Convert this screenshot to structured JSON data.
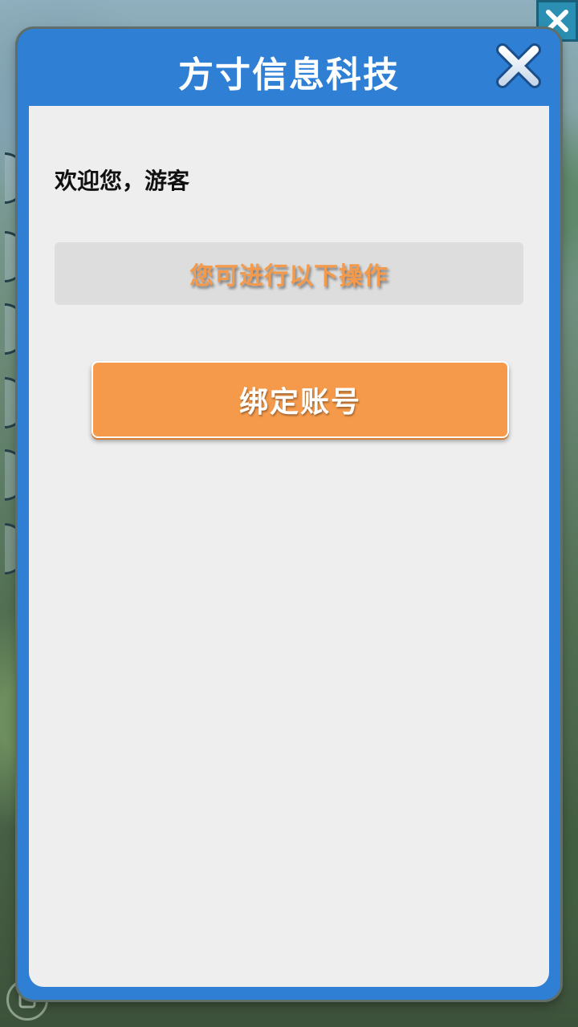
{
  "modal": {
    "title": "方寸信息科技",
    "close_icon": "close-x-icon"
  },
  "content": {
    "welcome": "欢迎您，游客",
    "operations_hint": "您可进行以下操作",
    "bind_account_label": "绑定账号"
  },
  "colors": {
    "modal_frame": "#2f7fd5",
    "body_bg": "#eeeeee",
    "accent_orange": "#f59a4a",
    "hint_orange": "#f39a4c"
  },
  "background": {
    "close_icon": "close-x-icon",
    "bottom_icon": "game-badge-icon"
  }
}
